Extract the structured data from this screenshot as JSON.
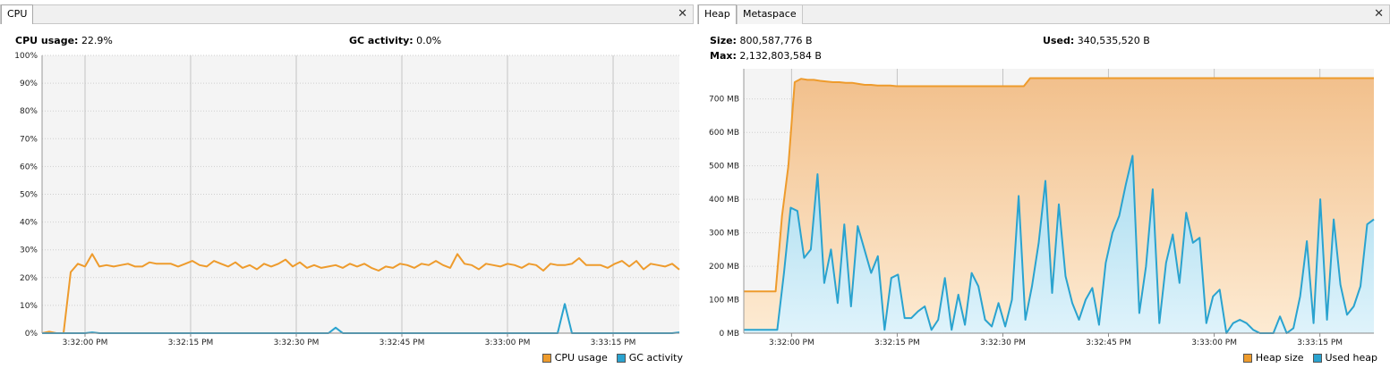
{
  "colors": {
    "orange": "#ee9b2c",
    "blue": "#2aa3cf",
    "plot_bg": "#f4f4f4"
  },
  "cpu": {
    "tab_label": "CPU",
    "close_icon": "close-icon",
    "cpu_usage_label": "CPU usage:",
    "cpu_usage_value": "22.9%",
    "gc_activity_label": "GC activity:",
    "gc_activity_value": "0.0%",
    "legend": {
      "cpu": "CPU usage",
      "gc": "GC activity"
    }
  },
  "heap": {
    "tabs": [
      "Heap",
      "Metaspace"
    ],
    "close_icon": "close-icon",
    "size_label": "Size:",
    "size_value": "800,587,776 B",
    "used_label": "Used:",
    "used_value": "340,535,520 B",
    "max_label": "Max:",
    "max_value": "2,132,803,584 B",
    "legend": {
      "size": "Heap size",
      "used": "Used heap"
    }
  },
  "chart_data": [
    {
      "type": "line",
      "ylim": [
        0,
        100
      ],
      "xlim": [
        "3:31:50 PM",
        "3:33:25 PM"
      ],
      "y_ticks": [
        "0%",
        "10%",
        "20%",
        "30%",
        "40%",
        "50%",
        "60%",
        "70%",
        "80%",
        "90%",
        "100%"
      ],
      "x_ticks": [
        "3:32:00 PM",
        "3:32:15 PM",
        "3:32:30 PM",
        "3:32:45 PM",
        "3:33:00 PM",
        "3:33:15 PM"
      ],
      "grid": true,
      "legend_position": "bottom-right",
      "series": [
        {
          "name": "CPU usage",
          "color": "#ee9b2c",
          "values": [
            0,
            0.5,
            0,
            0,
            22,
            25,
            24,
            28.5,
            24,
            24.5,
            24,
            24.5,
            25,
            24,
            24,
            25.5,
            25,
            25,
            25,
            24,
            25,
            26,
            24.5,
            24,
            26,
            25,
            24,
            25.5,
            23.5,
            24.5,
            23,
            25,
            24,
            25,
            26.5,
            24,
            25.5,
            23.5,
            24.5,
            23.5,
            24,
            24.5,
            23.5,
            25,
            24,
            25,
            23.5,
            22.5,
            24,
            23.5,
            25,
            24.5,
            23.5,
            25,
            24.5,
            26,
            24.5,
            23.5,
            28.5,
            25,
            24.5,
            23,
            25,
            24.5,
            24,
            25,
            24.5,
            23.5,
            25,
            24.5,
            22.5,
            25,
            24.5,
            24.5,
            25,
            27,
            24.5,
            24.5,
            24.5,
            23.5,
            25,
            26,
            24,
            26,
            23,
            25,
            24.5,
            24,
            25,
            22.9
          ]
        },
        {
          "name": "GC activity",
          "color": "#2aa3cf",
          "values": [
            0,
            0,
            0,
            0,
            0,
            0,
            0,
            0.3,
            0,
            0,
            0,
            0,
            0,
            0,
            0,
            0,
            0,
            0,
            0,
            0,
            0,
            0,
            0,
            0,
            0,
            0,
            0,
            0,
            0,
            0,
            0,
            0,
            0,
            0,
            0,
            0,
            0,
            0,
            0,
            0,
            0,
            2,
            0,
            0,
            0,
            0,
            0,
            0,
            0,
            0,
            0,
            0,
            0,
            0,
            0,
            0,
            0,
            0,
            0,
            0,
            0,
            0,
            0,
            0,
            0,
            0,
            0,
            0,
            0,
            0,
            0,
            0,
            0,
            10.5,
            0,
            0,
            0,
            0,
            0,
            0,
            0,
            0,
            0,
            0,
            0,
            0,
            0,
            0,
            0,
            0.3
          ]
        }
      ]
    },
    {
      "type": "area",
      "ylim": [
        0,
        790
      ],
      "xlim": [
        "3:31:53 PM",
        "3:33:25 PM"
      ],
      "y_ticks": [
        "0 MB",
        "100 MB",
        "200 MB",
        "300 MB",
        "400 MB",
        "500 MB",
        "600 MB",
        "700 MB"
      ],
      "x_ticks": [
        "3:32:00 PM",
        "3:32:15 PM",
        "3:32:30 PM",
        "3:32:45 PM",
        "3:33:00 PM",
        "3:33:15 PM"
      ],
      "grid": true,
      "legend_position": "bottom-right",
      "series": [
        {
          "name": "Heap size",
          "color": "#ee9b2c",
          "values": [
            125,
            125,
            125,
            125,
            125,
            125,
            350,
            500,
            750,
            760,
            757,
            757,
            754,
            752,
            750,
            750,
            748,
            748,
            745,
            742,
            742,
            740,
            740,
            740,
            738,
            738,
            738,
            738,
            738,
            738,
            738,
            738,
            738,
            738,
            738,
            738,
            738,
            738,
            738,
            738,
            738,
            738,
            738,
            738,
            738,
            762,
            762,
            762,
            762,
            762,
            762,
            762,
            762,
            762,
            762,
            762,
            762,
            762,
            762,
            762,
            762,
            762,
            762,
            762,
            762,
            762,
            762,
            762,
            762,
            762,
            762,
            762,
            762,
            762,
            762,
            762,
            762,
            762,
            762,
            762,
            762,
            762,
            762,
            762,
            762,
            762,
            762,
            762,
            762,
            762,
            762,
            762,
            762,
            762,
            762,
            762,
            762,
            762,
            762,
            762
          ]
        },
        {
          "name": "Used heap",
          "color": "#2aa3cf",
          "values": [
            10,
            10,
            10,
            10,
            10,
            10,
            180,
            375,
            365,
            225,
            250,
            475,
            150,
            250,
            90,
            325,
            80,
            320,
            250,
            180,
            230,
            10,
            165,
            175,
            45,
            45,
            65,
            80,
            10,
            40,
            165,
            10,
            115,
            25,
            180,
            140,
            40,
            20,
            90,
            20,
            100,
            410,
            40,
            140,
            270,
            455,
            120,
            385,
            170,
            90,
            40,
            100,
            135,
            25,
            210,
            300,
            350,
            445,
            530,
            60,
            200,
            430,
            30,
            210,
            295,
            150,
            360,
            270,
            285,
            30,
            110,
            130,
            0,
            30,
            40,
            30,
            10,
            0,
            0,
            0,
            50,
            0,
            15,
            110,
            275,
            30,
            400,
            40,
            340,
            145,
            55,
            80,
            140,
            325,
            340
          ]
        }
      ]
    }
  ]
}
